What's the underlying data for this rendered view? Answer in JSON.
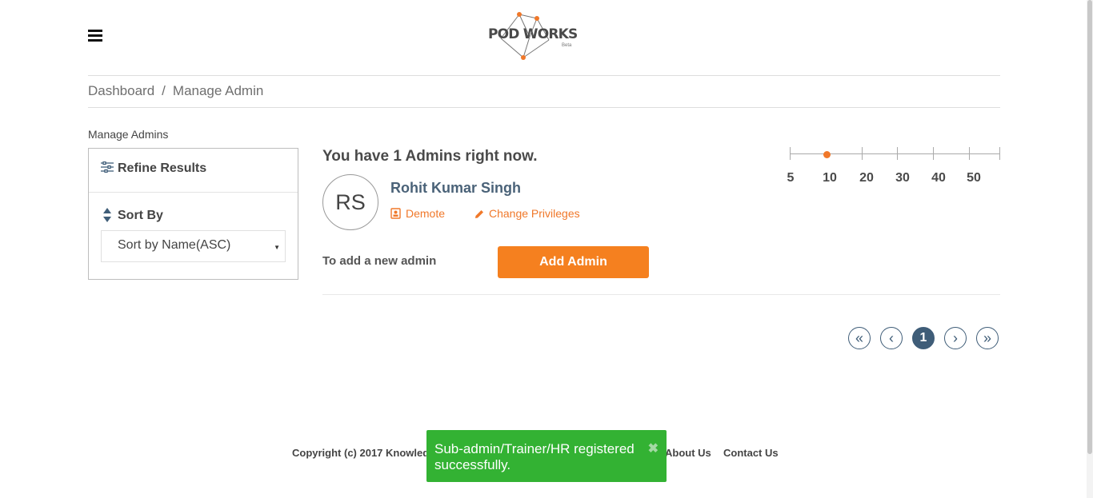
{
  "header": {
    "menu_icon": "hamburger-icon",
    "logo_text": "POD WORKS",
    "logo_beta": "Beta"
  },
  "breadcrumb": [
    "Dashboard",
    "Manage Admin"
  ],
  "breadcrumb_separator": "/",
  "sidebar": {
    "section_title": "Manage Admins",
    "refine_title": "Refine Results",
    "sort_label": "Sort By",
    "sort_value": "Sort by Name(ASC)"
  },
  "main": {
    "headline": "You have 1 Admins right now.",
    "admin": {
      "initials": "RS",
      "name": "Rohit Kumar Singh",
      "actions": [
        "Demote",
        "Change Privileges"
      ]
    },
    "add_label": "To add a new admin",
    "add_button": "Add Admin"
  },
  "page_size": {
    "options": [
      "5",
      "10",
      "20",
      "30",
      "40",
      "50"
    ],
    "selected": "10"
  },
  "pagination": {
    "first": "«",
    "prev": "‹",
    "current": "1",
    "next": "›",
    "last": "»"
  },
  "footer": {
    "copyright": "Copyright (c) 2017 Knowled",
    "about": "About Us",
    "contact": "Contact Us"
  },
  "toast": {
    "message": "Sub-admin/Trainer/HR registered successfully.",
    "close": "✖"
  },
  "colors": {
    "accent": "#f5801f",
    "primary": "#3f5d78",
    "success": "#33b233"
  }
}
